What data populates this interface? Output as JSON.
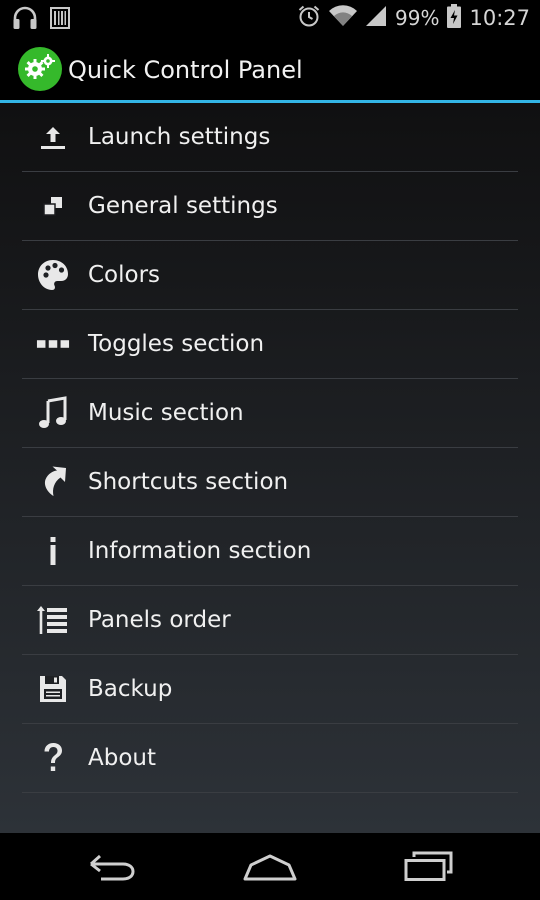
{
  "status_bar": {
    "battery": "99%",
    "time": "10:27",
    "icons": [
      "headphones-icon",
      "barcode-icon",
      "alarm-icon",
      "wifi-icon",
      "signal-icon",
      "battery-charging-icon"
    ]
  },
  "action_bar": {
    "title": "Quick Control Panel",
    "icon": "gears-icon",
    "accent_color": "#33b5e5",
    "icon_color": "#35b92b"
  },
  "menu": {
    "items": [
      {
        "label": "Launch settings",
        "icon": "upload-icon"
      },
      {
        "label": "General settings",
        "icon": "general-squares-icon"
      },
      {
        "label": "Colors",
        "icon": "palette-icon"
      },
      {
        "label": "Toggles section",
        "icon": "toggles-dots-icon"
      },
      {
        "label": "Music section",
        "icon": "music-note-icon"
      },
      {
        "label": "Shortcuts section",
        "icon": "shortcut-arrow-icon"
      },
      {
        "label": "Information section",
        "icon": "info-icon"
      },
      {
        "label": "Panels order",
        "icon": "reorder-list-icon"
      },
      {
        "label": "Backup",
        "icon": "floppy-disk-icon"
      },
      {
        "label": "About",
        "icon": "question-mark-icon"
      }
    ]
  },
  "nav_bar": {
    "buttons": [
      "back",
      "home",
      "recents"
    ]
  }
}
